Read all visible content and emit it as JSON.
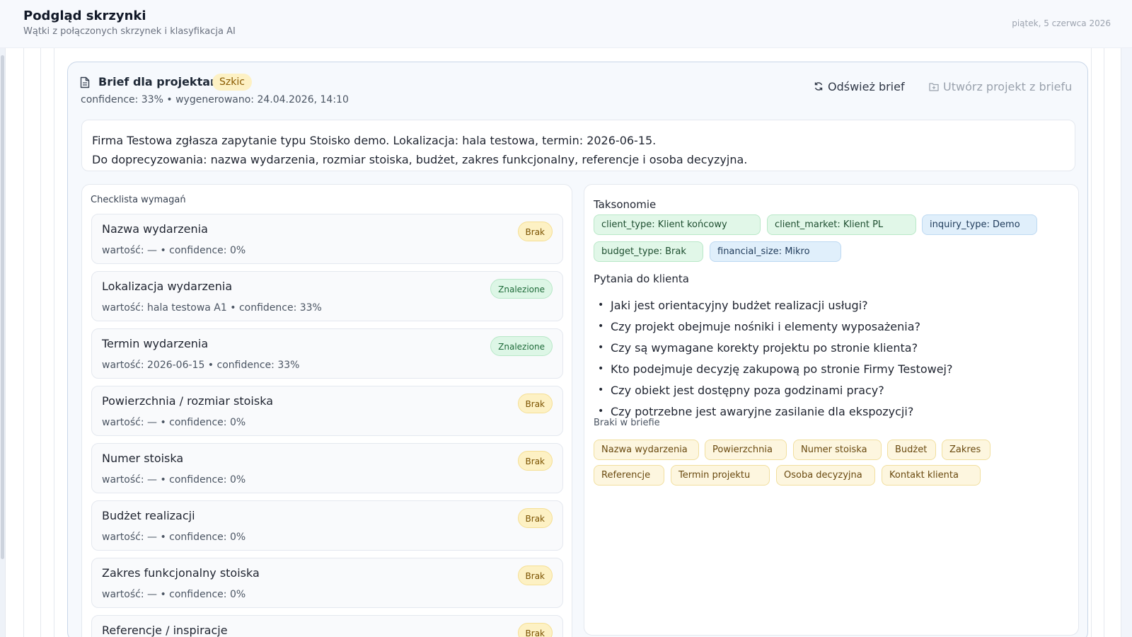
{
  "header": {
    "title": "Podgląd skrzynki",
    "subtitle": "Wątki z połączonych skrzynek i klasyfikacja AI",
    "date": "piątek, 5 czerwca 2026"
  },
  "brief": {
    "title": "Brief dla projektanta",
    "status_badge": "Szkic",
    "meta": "confidence: 33% • wygenerowano: 24.04.2026, 14:10",
    "refresh_label": "Odśwież brief",
    "create_label": "Utwórz projekt z briefu",
    "summary_line1": "Firma Testowa zgłasza zapytanie typu Stoisko demo. Lokalizacja: hala testowa, termin: 2026-06-15.",
    "summary_line2": "Do doprecyzowania: nazwa wydarzenia, rozmiar stoiska, budżet, zakres funkcjonalny, referencje i osoba decyzyjna."
  },
  "checklist": {
    "heading": "Checklista wymagań",
    "items": [
      {
        "name": "Nazwa wydarzenia",
        "value": "wartość: — • confidence: 0%",
        "status": "Brak"
      },
      {
        "name": "Lokalizacja wydarzenia",
        "value": "wartość: hala testowa A1 • confidence: 33%",
        "status": "Znalezione"
      },
      {
        "name": "Termin wydarzenia",
        "value": "wartość: 2026-06-15 • confidence: 33%",
        "status": "Znalezione"
      },
      {
        "name": "Powierzchnia / rozmiar stoiska",
        "value": "wartość: — • confidence: 0%",
        "status": "Brak"
      },
      {
        "name": "Numer stoiska",
        "value": "wartość: — • confidence: 0%",
        "status": "Brak"
      },
      {
        "name": "Budżet realizacji",
        "value": "wartość: — • confidence: 0%",
        "status": "Brak"
      },
      {
        "name": "Zakres funkcjonalny stoiska",
        "value": "wartość: — • confidence: 0%",
        "status": "Brak"
      },
      {
        "name": "Referencje / inspiracje",
        "value": "",
        "status": "Brak"
      }
    ]
  },
  "taxonomies": {
    "label": "Taksonomie",
    "chips": [
      "client_type: Klient końcowy",
      "client_market: Klient PL",
      "inquiry_type: Demo",
      "budget_type: Brak",
      "financial_size: Mikro"
    ]
  },
  "questions": {
    "label": "Pytania do klienta",
    "items": [
      "Jaki jest orientacyjny budżet realizacji usługi?",
      "Czy projekt obejmuje nośniki i elementy wyposażenia?",
      "Czy są wymagane korekty projektu po stronie klienta?",
      "Kto podejmuje decyzję zakupową po stronie Firmy Testowej?",
      "Czy obiekt jest dostępny poza godzinami pracy?",
      "Czy potrzebne jest awaryjne zasilanie dla ekspozycji?"
    ]
  },
  "gaps": {
    "label": "Braki w briefie",
    "chips": [
      "Nazwa wydarzenia",
      "Powierzchnia",
      "Numer stoiska",
      "Budżet",
      "Zakres",
      "Referencje",
      "Termin projektu",
      "Osoba decyzyjna",
      "Kontakt klienta"
    ]
  }
}
